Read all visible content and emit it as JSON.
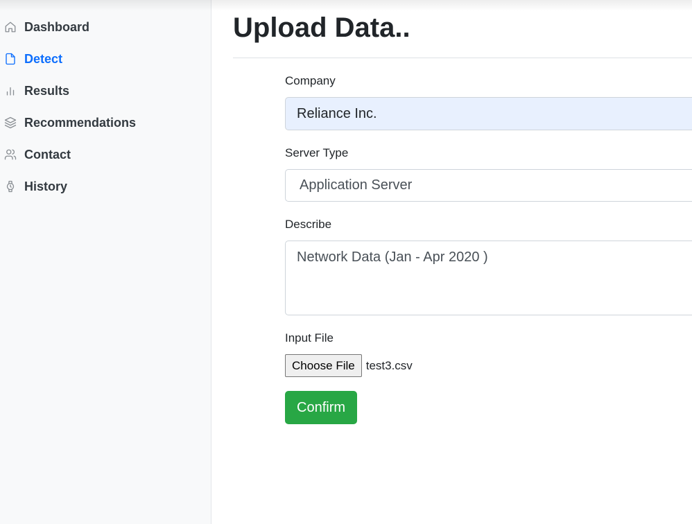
{
  "sidebar": {
    "items": [
      {
        "label": "Dashboard",
        "icon": "home-icon"
      },
      {
        "label": "Detect",
        "icon": "file-icon",
        "active": true
      },
      {
        "label": "Results",
        "icon": "bar-chart-icon"
      },
      {
        "label": "Recommendations",
        "icon": "layers-icon"
      },
      {
        "label": "Contact",
        "icon": "users-icon"
      },
      {
        "label": "History",
        "icon": "watch-icon"
      }
    ]
  },
  "main": {
    "title": "Upload Data..",
    "form": {
      "company_label": "Company",
      "company_value": "Reliance Inc.",
      "server_label": "Server Type",
      "server_value": "Application Server",
      "describe_label": "Describe",
      "describe_value": "Network Data (Jan - Apr 2020 )",
      "file_label": "Input File",
      "file_button": "Choose File",
      "file_name": "test3.csv",
      "confirm_label": "Confirm"
    }
  },
  "colors": {
    "accent": "#0d6efd",
    "confirm": "#28a745",
    "autofill": "#e8f0fe",
    "sidebar_bg": "#f8f9fa"
  }
}
